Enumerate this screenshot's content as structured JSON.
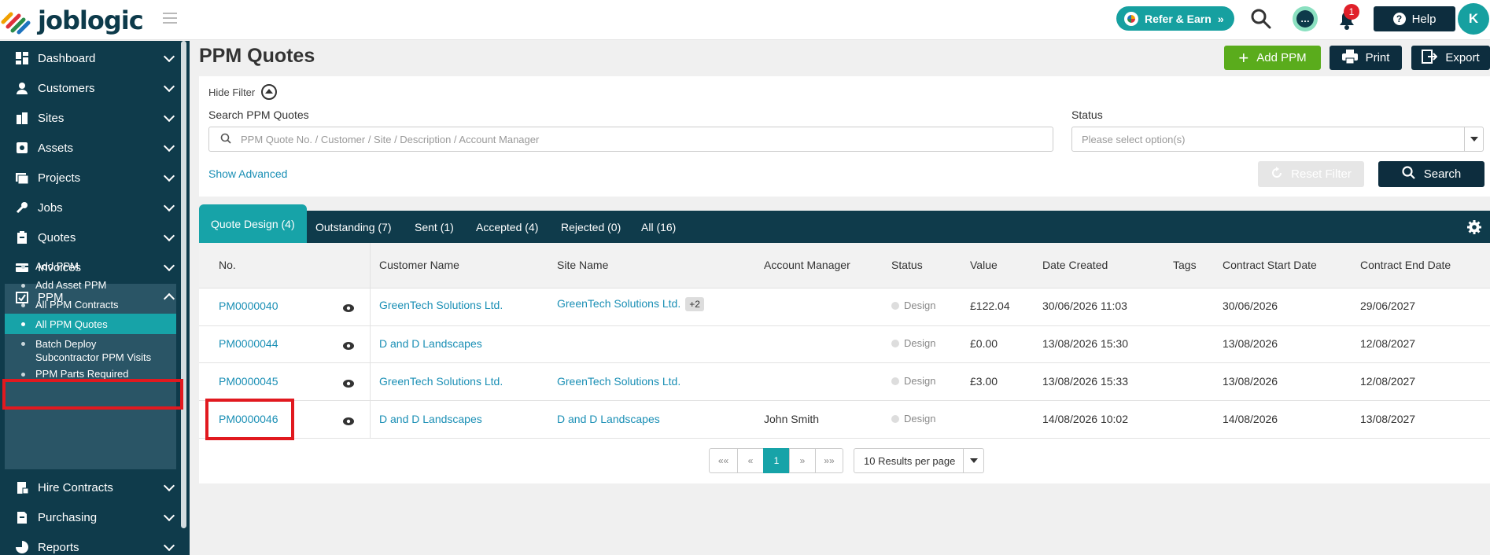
{
  "header": {
    "logo_text": "joblogic",
    "refer_label": "Refer & Earn",
    "notification_count": "1",
    "help_label": "Help",
    "avatar_initial": "K"
  },
  "sidebar": {
    "items": [
      {
        "label": "Dashboard",
        "icon": "dashboard-icon"
      },
      {
        "label": "Customers",
        "icon": "user-icon"
      },
      {
        "label": "Sites",
        "icon": "building-icon"
      },
      {
        "label": "Assets",
        "icon": "asset-icon"
      },
      {
        "label": "Projects",
        "icon": "projects-icon"
      },
      {
        "label": "Jobs",
        "icon": "wrench-icon"
      },
      {
        "label": "Quotes",
        "icon": "clipboard-icon"
      },
      {
        "label": "Invoices",
        "icon": "invoice-icon"
      },
      {
        "label": "PPM",
        "icon": "ppm-icon"
      },
      {
        "label": "Hire Contracts",
        "icon": "hire-icon"
      },
      {
        "label": "Purchasing",
        "icon": "purchasing-icon"
      },
      {
        "label": "Reports",
        "icon": "reports-icon"
      }
    ],
    "ppm_sub": [
      {
        "label": "Add PPM"
      },
      {
        "label": "Add Asset PPM"
      },
      {
        "label": "All PPM Contracts"
      },
      {
        "label": "All PPM Quotes"
      },
      {
        "label": "Batch Deploy Subcontractor PPM Visits"
      },
      {
        "label": "PPM Parts Required"
      }
    ]
  },
  "page": {
    "title": "PPM Quotes",
    "add_label": "Add PPM",
    "print_label": "Print",
    "export_label": "Export"
  },
  "filter": {
    "hide_label": "Hide Filter",
    "search_label": "Search PPM Quotes",
    "search_placeholder": "PPM Quote No. / Customer / Site / Description / Account Manager",
    "status_label": "Status",
    "status_placeholder": "Please select option(s)",
    "show_advanced": "Show Advanced",
    "reset_label": "Reset Filter",
    "search_button": "Search"
  },
  "tabs": [
    {
      "label": "Quote Design (4)"
    },
    {
      "label": "Outstanding (7)"
    },
    {
      "label": "Sent (1)"
    },
    {
      "label": "Accepted (4)"
    },
    {
      "label": "Rejected (0)"
    },
    {
      "label": "All (16)"
    }
  ],
  "table": {
    "headers": [
      "No.",
      "Customer Name",
      "Site Name",
      "Account Manager",
      "Status",
      "Value",
      "Date Created",
      "Tags",
      "Contract Start Date",
      "Contract End Date"
    ],
    "rows": [
      {
        "no": "PM0000040",
        "customer": "GreenTech Solutions Ltd.",
        "site": "GreenTech Solutions Ltd.",
        "site_extra": "+2",
        "manager": "",
        "status": "Design",
        "value": "£122.04",
        "created": "30/06/2026 11:03",
        "tags": "",
        "start": "30/06/2026",
        "end": "29/06/2027"
      },
      {
        "no": "PM0000044",
        "customer": "D and D Landscapes",
        "site": "",
        "site_extra": "",
        "manager": "",
        "status": "Design",
        "value": "£0.00",
        "created": "13/08/2026 15:30",
        "tags": "",
        "start": "13/08/2026",
        "end": "12/08/2027"
      },
      {
        "no": "PM0000045",
        "customer": "GreenTech Solutions Ltd.",
        "site": "GreenTech Solutions Ltd.",
        "site_extra": "",
        "manager": "",
        "status": "Design",
        "value": "£3.00",
        "created": "13/08/2026 15:33",
        "tags": "",
        "start": "13/08/2026",
        "end": "12/08/2027"
      },
      {
        "no": "PM0000046",
        "customer": "D and D Landscapes",
        "site": "D and D Landscapes",
        "site_extra": "",
        "manager": "John Smith",
        "status": "Design",
        "value": "",
        "created": "14/08/2026 10:02",
        "tags": "",
        "start": "14/08/2026",
        "end": "13/08/2027"
      }
    ]
  },
  "pagination": {
    "first": "««",
    "prev": "«",
    "current": "1",
    "next": "»",
    "last": "»»",
    "per_page": "10 Results per page"
  },
  "colors": {
    "sidebar": "#0f3b4b",
    "accent": "#17a3a8",
    "link": "#1a8fb5",
    "add_button": "#5aac1c",
    "highlight": "#e1191f"
  }
}
